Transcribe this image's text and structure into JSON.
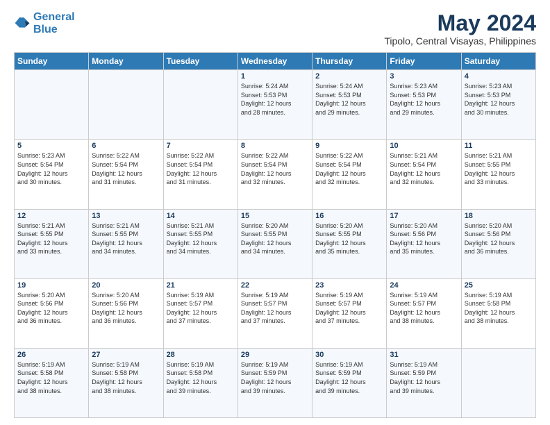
{
  "logo": {
    "line1": "General",
    "line2": "Blue"
  },
  "title": "May 2024",
  "location": "Tipolo, Central Visayas, Philippines",
  "weekdays": [
    "Sunday",
    "Monday",
    "Tuesday",
    "Wednesday",
    "Thursday",
    "Friday",
    "Saturday"
  ],
  "weeks": [
    [
      {
        "day": "",
        "info": ""
      },
      {
        "day": "",
        "info": ""
      },
      {
        "day": "",
        "info": ""
      },
      {
        "day": "1",
        "info": "Sunrise: 5:24 AM\nSunset: 5:53 PM\nDaylight: 12 hours\nand 28 minutes."
      },
      {
        "day": "2",
        "info": "Sunrise: 5:24 AM\nSunset: 5:53 PM\nDaylight: 12 hours\nand 29 minutes."
      },
      {
        "day": "3",
        "info": "Sunrise: 5:23 AM\nSunset: 5:53 PM\nDaylight: 12 hours\nand 29 minutes."
      },
      {
        "day": "4",
        "info": "Sunrise: 5:23 AM\nSunset: 5:53 PM\nDaylight: 12 hours\nand 30 minutes."
      }
    ],
    [
      {
        "day": "5",
        "info": "Sunrise: 5:23 AM\nSunset: 5:54 PM\nDaylight: 12 hours\nand 30 minutes."
      },
      {
        "day": "6",
        "info": "Sunrise: 5:22 AM\nSunset: 5:54 PM\nDaylight: 12 hours\nand 31 minutes."
      },
      {
        "day": "7",
        "info": "Sunrise: 5:22 AM\nSunset: 5:54 PM\nDaylight: 12 hours\nand 31 minutes."
      },
      {
        "day": "8",
        "info": "Sunrise: 5:22 AM\nSunset: 5:54 PM\nDaylight: 12 hours\nand 32 minutes."
      },
      {
        "day": "9",
        "info": "Sunrise: 5:22 AM\nSunset: 5:54 PM\nDaylight: 12 hours\nand 32 minutes."
      },
      {
        "day": "10",
        "info": "Sunrise: 5:21 AM\nSunset: 5:54 PM\nDaylight: 12 hours\nand 32 minutes."
      },
      {
        "day": "11",
        "info": "Sunrise: 5:21 AM\nSunset: 5:55 PM\nDaylight: 12 hours\nand 33 minutes."
      }
    ],
    [
      {
        "day": "12",
        "info": "Sunrise: 5:21 AM\nSunset: 5:55 PM\nDaylight: 12 hours\nand 33 minutes."
      },
      {
        "day": "13",
        "info": "Sunrise: 5:21 AM\nSunset: 5:55 PM\nDaylight: 12 hours\nand 34 minutes."
      },
      {
        "day": "14",
        "info": "Sunrise: 5:21 AM\nSunset: 5:55 PM\nDaylight: 12 hours\nand 34 minutes."
      },
      {
        "day": "15",
        "info": "Sunrise: 5:20 AM\nSunset: 5:55 PM\nDaylight: 12 hours\nand 34 minutes."
      },
      {
        "day": "16",
        "info": "Sunrise: 5:20 AM\nSunset: 5:55 PM\nDaylight: 12 hours\nand 35 minutes."
      },
      {
        "day": "17",
        "info": "Sunrise: 5:20 AM\nSunset: 5:56 PM\nDaylight: 12 hours\nand 35 minutes."
      },
      {
        "day": "18",
        "info": "Sunrise: 5:20 AM\nSunset: 5:56 PM\nDaylight: 12 hours\nand 36 minutes."
      }
    ],
    [
      {
        "day": "19",
        "info": "Sunrise: 5:20 AM\nSunset: 5:56 PM\nDaylight: 12 hours\nand 36 minutes."
      },
      {
        "day": "20",
        "info": "Sunrise: 5:20 AM\nSunset: 5:56 PM\nDaylight: 12 hours\nand 36 minutes."
      },
      {
        "day": "21",
        "info": "Sunrise: 5:19 AM\nSunset: 5:57 PM\nDaylight: 12 hours\nand 37 minutes."
      },
      {
        "day": "22",
        "info": "Sunrise: 5:19 AM\nSunset: 5:57 PM\nDaylight: 12 hours\nand 37 minutes."
      },
      {
        "day": "23",
        "info": "Sunrise: 5:19 AM\nSunset: 5:57 PM\nDaylight: 12 hours\nand 37 minutes."
      },
      {
        "day": "24",
        "info": "Sunrise: 5:19 AM\nSunset: 5:57 PM\nDaylight: 12 hours\nand 38 minutes."
      },
      {
        "day": "25",
        "info": "Sunrise: 5:19 AM\nSunset: 5:58 PM\nDaylight: 12 hours\nand 38 minutes."
      }
    ],
    [
      {
        "day": "26",
        "info": "Sunrise: 5:19 AM\nSunset: 5:58 PM\nDaylight: 12 hours\nand 38 minutes."
      },
      {
        "day": "27",
        "info": "Sunrise: 5:19 AM\nSunset: 5:58 PM\nDaylight: 12 hours\nand 38 minutes."
      },
      {
        "day": "28",
        "info": "Sunrise: 5:19 AM\nSunset: 5:58 PM\nDaylight: 12 hours\nand 39 minutes."
      },
      {
        "day": "29",
        "info": "Sunrise: 5:19 AM\nSunset: 5:59 PM\nDaylight: 12 hours\nand 39 minutes."
      },
      {
        "day": "30",
        "info": "Sunrise: 5:19 AM\nSunset: 5:59 PM\nDaylight: 12 hours\nand 39 minutes."
      },
      {
        "day": "31",
        "info": "Sunrise: 5:19 AM\nSunset: 5:59 PM\nDaylight: 12 hours\nand 39 minutes."
      },
      {
        "day": "",
        "info": ""
      }
    ]
  ]
}
